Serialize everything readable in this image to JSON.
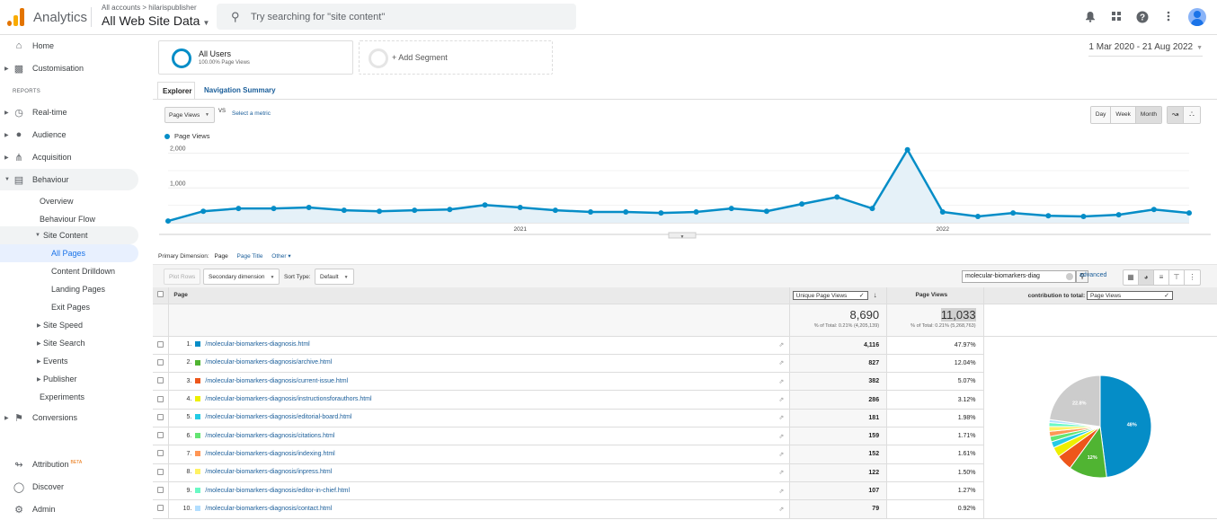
{
  "topbar": {
    "app_name": "Analytics",
    "breadcrumb": "All accounts > hilarispublisher",
    "property": "All Web Site Data",
    "search_placeholder": "Try searching for \"site content\"",
    "icons": [
      "bell-icon",
      "apps-grid-icon",
      "help-icon",
      "more-vert-icon",
      "account-avatar"
    ]
  },
  "sidebar": {
    "home": "Home",
    "customisation": "Customisation",
    "reports_label": "REPORTS",
    "realtime": "Real-time",
    "audience": "Audience",
    "acquisition": "Acquisition",
    "behaviour": "Behaviour",
    "overview": "Overview",
    "behaviour_flow": "Behaviour Flow",
    "site_content": "Site Content",
    "all_pages": "All Pages",
    "content_drilldown": "Content Drilldown",
    "landing_pages": "Landing Pages",
    "exit_pages": "Exit Pages",
    "site_speed": "Site Speed",
    "site_search": "Site Search",
    "events": "Events",
    "publisher": "Publisher",
    "experiments": "Experiments",
    "conversions": "Conversions",
    "attribution": "Attribution",
    "beta": "BETA",
    "discover": "Discover",
    "admin": "Admin"
  },
  "segments": {
    "all_users": "All Users",
    "all_users_sub": "100.00% Page Views",
    "add_segment": "+ Add Segment"
  },
  "date_range": "1 Mar 2020 - 21 Aug 2022",
  "tabs": {
    "explorer": "Explorer",
    "nav_summary": "Navigation Summary"
  },
  "metric": {
    "selected": "Page Views",
    "vs": "VS",
    "select_metric": "Select a metric"
  },
  "granularity": {
    "day": "Day",
    "week": "Week",
    "month": "Month",
    "active": "Month"
  },
  "chart_data": {
    "type": "area",
    "series": [
      {
        "name": "Page Views",
        "color": "#058dc7",
        "values": [
          50,
          330,
          410,
          410,
          440,
          360,
          330,
          360,
          380,
          510,
          440,
          360,
          310,
          310,
          280,
          310,
          410,
          330,
          540,
          740,
          410,
          2100,
          310,
          180,
          280,
          200,
          180,
          230,
          380,
          280
        ]
      }
    ],
    "x": [
      "Mar 2020",
      "Apr 2020",
      "May 2020",
      "Jun 2020",
      "Jul 2020",
      "Aug 2020",
      "Sep 2020",
      "Oct 2020",
      "Nov 2020",
      "Dec 2020",
      "Jan 2021",
      "Feb 2021",
      "Mar 2021",
      "Apr 2021",
      "May 2021",
      "Jun 2021",
      "Jul 2021",
      "Aug 2021",
      "Sep 2021",
      "Oct 2021",
      "Nov 2021",
      "Dec 2021",
      "Jan 2022",
      "Feb 2022",
      "Mar 2022",
      "Apr 2022",
      "May 2022",
      "Jun 2022",
      "Jul 2022",
      "Aug 2022"
    ],
    "x_tick_labels": [
      {
        "index": 10,
        "label": "2021"
      },
      {
        "index": 22,
        "label": "2022"
      }
    ],
    "y_ticks": [
      {
        "value": 1000,
        "label": "1,000"
      },
      {
        "value": 2000,
        "label": "2,000"
      }
    ],
    "ylim": [
      0,
      2300
    ],
    "legend": "top-left",
    "grid": true
  },
  "primary_dimension": {
    "label": "Primary Dimension:",
    "current": "Page",
    "options": [
      "Page Title",
      "Other"
    ]
  },
  "toolbar": {
    "plot_rows": "Plot Rows",
    "secondary_dimension": "Secondary dimension",
    "sort_type_label": "Sort Type:",
    "sort_type": "Default",
    "filter_value": "molecular-biomarkers-diag",
    "advanced": "advanced"
  },
  "table": {
    "col_page": "Page",
    "col_unique": "Unique Page Views",
    "col_pageviews": "Page Views",
    "col_contrib_label": "contribution to total:",
    "col_contrib_metric": "Page Views",
    "totals": {
      "unique": "8,690",
      "unique_sub": "% of Total: 0.21% (4,205,139)",
      "pageviews": "11,033",
      "pageviews_sub": "% of Total: 0.21% (5,268,763)"
    },
    "rows": [
      {
        "n": "1.",
        "page": "/molecular-biomarkers-diagnosis.html",
        "unique": "4,116",
        "pct": "47.97%",
        "color": "#058dc7"
      },
      {
        "n": "2.",
        "page": "/molecular-biomarkers-diagnosis/archive.html",
        "unique": "827",
        "pct": "12.04%",
        "color": "#50b432"
      },
      {
        "n": "3.",
        "page": "/molecular-biomarkers-diagnosis/current-issue.html",
        "unique": "382",
        "pct": "5.07%",
        "color": "#ed561b"
      },
      {
        "n": "4.",
        "page": "/molecular-biomarkers-diagnosis/instructionsforauthors.html",
        "unique": "286",
        "pct": "3.12%",
        "color": "#edef00"
      },
      {
        "n": "5.",
        "page": "/molecular-biomarkers-diagnosis/editorial-board.html",
        "unique": "181",
        "pct": "1.98%",
        "color": "#24cbe5"
      },
      {
        "n": "6.",
        "page": "/molecular-biomarkers-diagnosis/citations.html",
        "unique": "159",
        "pct": "1.71%",
        "color": "#64e572"
      },
      {
        "n": "7.",
        "page": "/molecular-biomarkers-diagnosis/indexing.html",
        "unique": "152",
        "pct": "1.61%",
        "color": "#ff9655"
      },
      {
        "n": "8.",
        "page": "/molecular-biomarkers-diagnosis/inpress.html",
        "unique": "122",
        "pct": "1.50%",
        "color": "#fff263"
      },
      {
        "n": "9.",
        "page": "/molecular-biomarkers-diagnosis/editor-in-chief.html",
        "unique": "107",
        "pct": "1.27%",
        "color": "#6af9c4"
      },
      {
        "n": "10.",
        "page": "/molecular-biomarkers-diagnosis/contact.html",
        "unique": "79",
        "pct": "0.92%",
        "color": "#b2deff"
      }
    ]
  },
  "pie": {
    "slices": [
      {
        "value": 47.97,
        "color": "#058dc7",
        "label": "48%"
      },
      {
        "value": 12.04,
        "color": "#50b432",
        "label": "12%"
      },
      {
        "value": 5.07,
        "color": "#ed561b",
        "label": ""
      },
      {
        "value": 3.12,
        "color": "#edef00",
        "label": ""
      },
      {
        "value": 1.98,
        "color": "#24cbe5",
        "label": ""
      },
      {
        "value": 1.71,
        "color": "#64e572",
        "label": ""
      },
      {
        "value": 1.61,
        "color": "#ff9655",
        "label": ""
      },
      {
        "value": 1.5,
        "color": "#fff263",
        "label": ""
      },
      {
        "value": 1.27,
        "color": "#6af9c4",
        "label": ""
      },
      {
        "value": 0.92,
        "color": "#b2deff",
        "label": ""
      },
      {
        "value": 22.81,
        "color": "#cccccc",
        "label": "22.8%"
      }
    ]
  }
}
